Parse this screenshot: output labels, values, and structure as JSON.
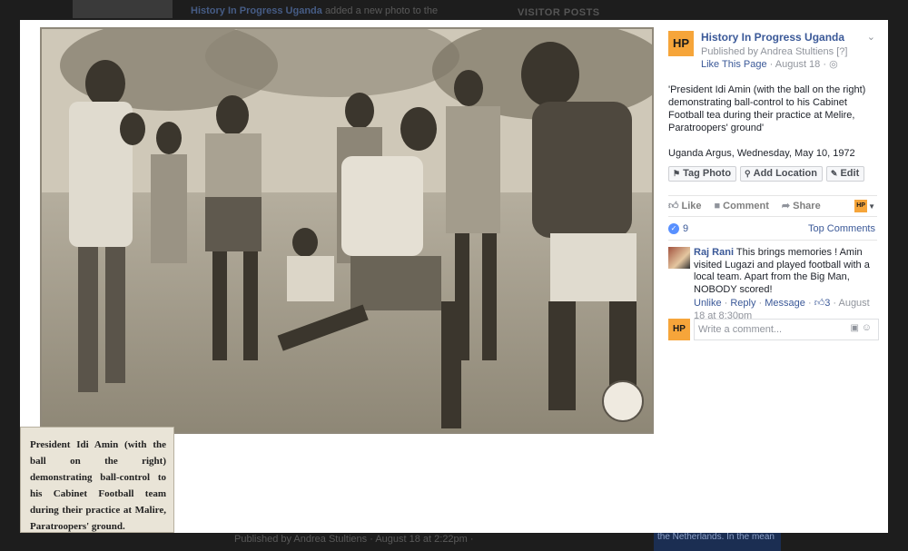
{
  "background_page": {
    "top_post_author": "History In Progress Uganda",
    "top_post_action": "added a new photo to the",
    "right_heading": "VISITOR POSTS",
    "bottom_text": "Published by Andrea Stultiens · August 18 at 2:22pm ·",
    "bottom_right_text": "the Netherlands. In the mean"
  },
  "photo": {
    "caption": "President Idi Amin (with the ball on the right) demonstrating ball-control to his Cabinet Football team during their practice at Malire, Paratroopers' ground."
  },
  "sidebar": {
    "page_avatar": "HP",
    "page_name": "History In Progress Uganda",
    "published_by": "Published by Andrea Stultiens",
    "published_help": "[?]",
    "like_this_page": "Like This Page",
    "date": "· August 18 ·",
    "globe_icon": "globe-icon",
    "post_paragraphs": [
      "'President Idi Amin (with the ball on the right) demonstrating ball-control to his Cabinet Football tea during their practice at Melire, Paratroopers' ground'",
      "Uganda Argus, Wednesday, May 10, 1972"
    ],
    "actions": {
      "tag_photo": "Tag Photo",
      "add_location": "Add Location",
      "edit": "Edit"
    },
    "ufi": {
      "like": "Like",
      "comment": "Comment",
      "share": "Share"
    },
    "reaction_count": "9",
    "top_comments": "Top Comments",
    "comment": {
      "author": "Raj Rani",
      "text": "This brings memories ! Amin visited Lugazi and played football with a local team. Apart from the Big Man, NOBODY scored!",
      "unlike": "Unlike",
      "reply": "Reply",
      "message": "Message",
      "likes": "3",
      "time": "August 18 at 8:30pm"
    },
    "write_placeholder": "Write a comment..."
  }
}
